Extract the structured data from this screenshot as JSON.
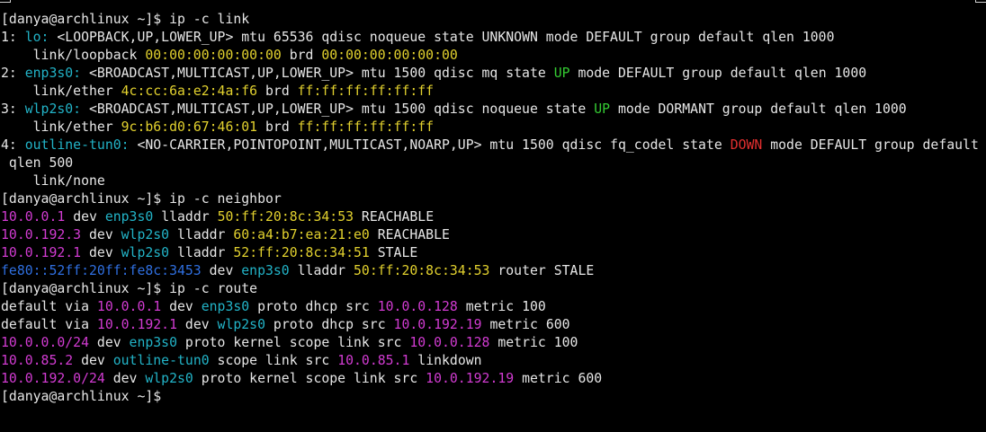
{
  "terminal": {
    "colors": {
      "background": "#000000",
      "default": "#e6e6e6",
      "cyan": "#22b3c7",
      "yellow": "#e2d12e",
      "magenta": "#d13bd1",
      "green": "#35cc33",
      "red": "#e32f2f",
      "blue": "#2f6fe0"
    },
    "lines": [
      [
        {
          "t": "[danya@archlinux ~]$ ip -c link",
          "c": "default"
        }
      ],
      [
        {
          "t": "1: ",
          "c": "default"
        },
        {
          "t": "lo:",
          "c": "cyan"
        },
        {
          "t": " <LOOPBACK,UP,LOWER_UP> mtu 65536 qdisc noqueue state UNKNOWN mode DEFAULT group default qlen 1000",
          "c": "default"
        }
      ],
      [
        {
          "t": "    link/loopback ",
          "c": "default"
        },
        {
          "t": "00:00:00:00:00:00",
          "c": "yellow"
        },
        {
          "t": " brd ",
          "c": "default"
        },
        {
          "t": "00:00:00:00:00:00",
          "c": "yellow"
        }
      ],
      [
        {
          "t": "2: ",
          "c": "default"
        },
        {
          "t": "enp3s0:",
          "c": "cyan"
        },
        {
          "t": " <BROADCAST,MULTICAST,UP,LOWER_UP> mtu 1500 qdisc mq state ",
          "c": "default"
        },
        {
          "t": "UP",
          "c": "green"
        },
        {
          "t": " mode DEFAULT group default qlen 1000",
          "c": "default"
        }
      ],
      [
        {
          "t": "    link/ether ",
          "c": "default"
        },
        {
          "t": "4c:cc:6a:e2:4a:f6",
          "c": "yellow"
        },
        {
          "t": " brd ",
          "c": "default"
        },
        {
          "t": "ff:ff:ff:ff:ff:ff",
          "c": "yellow"
        }
      ],
      [
        {
          "t": "3: ",
          "c": "default"
        },
        {
          "t": "wlp2s0:",
          "c": "cyan"
        },
        {
          "t": " <BROADCAST,MULTICAST,UP,LOWER_UP> mtu 1500 qdisc noqueue state ",
          "c": "default"
        },
        {
          "t": "UP",
          "c": "green"
        },
        {
          "t": " mode DORMANT group default qlen 1000",
          "c": "default"
        }
      ],
      [
        {
          "t": "    link/ether ",
          "c": "default"
        },
        {
          "t": "9c:b6:d0:67:46:01",
          "c": "yellow"
        },
        {
          "t": " brd ",
          "c": "default"
        },
        {
          "t": "ff:ff:ff:ff:ff:ff",
          "c": "yellow"
        }
      ],
      [
        {
          "t": "4: ",
          "c": "default"
        },
        {
          "t": "outline-tun0:",
          "c": "cyan"
        },
        {
          "t": " <NO-CARRIER,POINTOPOINT,MULTICAST,NOARP,UP> mtu 1500 qdisc fq_codel state ",
          "c": "default"
        },
        {
          "t": "DOWN",
          "c": "red"
        },
        {
          "t": " mode DEFAULT group default",
          "c": "default"
        }
      ],
      [
        {
          "t": " qlen 500",
          "c": "default"
        }
      ],
      [
        {
          "t": "    link/none",
          "c": "default"
        }
      ],
      [
        {
          "t": "[danya@archlinux ~]$ ip -c neighbor",
          "c": "default"
        }
      ],
      [
        {
          "t": "10.0.0.1",
          "c": "magenta"
        },
        {
          "t": " dev ",
          "c": "default"
        },
        {
          "t": "enp3s0",
          "c": "cyan"
        },
        {
          "t": " lladdr ",
          "c": "default"
        },
        {
          "t": "50:ff:20:8c:34:53",
          "c": "yellow"
        },
        {
          "t": " REACHABLE",
          "c": "default"
        }
      ],
      [
        {
          "t": "10.0.192.3",
          "c": "magenta"
        },
        {
          "t": " dev ",
          "c": "default"
        },
        {
          "t": "wlp2s0",
          "c": "cyan"
        },
        {
          "t": " lladdr ",
          "c": "default"
        },
        {
          "t": "60:a4:b7:ea:21:e0",
          "c": "yellow"
        },
        {
          "t": " REACHABLE",
          "c": "default"
        }
      ],
      [
        {
          "t": "10.0.192.1",
          "c": "magenta"
        },
        {
          "t": " dev ",
          "c": "default"
        },
        {
          "t": "wlp2s0",
          "c": "cyan"
        },
        {
          "t": " lladdr ",
          "c": "default"
        },
        {
          "t": "52:ff:20:8c:34:51",
          "c": "yellow"
        },
        {
          "t": " STALE",
          "c": "default"
        }
      ],
      [
        {
          "t": "fe80::52ff:20ff:fe8c:3453",
          "c": "blue"
        },
        {
          "t": " dev ",
          "c": "default"
        },
        {
          "t": "enp3s0",
          "c": "cyan"
        },
        {
          "t": " lladdr ",
          "c": "default"
        },
        {
          "t": "50:ff:20:8c:34:53",
          "c": "yellow"
        },
        {
          "t": " router STALE",
          "c": "default"
        }
      ],
      [
        {
          "t": "[danya@archlinux ~]$ ip -c route",
          "c": "default"
        }
      ],
      [
        {
          "t": "default via ",
          "c": "default"
        },
        {
          "t": "10.0.0.1",
          "c": "magenta"
        },
        {
          "t": " dev ",
          "c": "default"
        },
        {
          "t": "enp3s0",
          "c": "cyan"
        },
        {
          "t": " proto dhcp src ",
          "c": "default"
        },
        {
          "t": "10.0.0.128",
          "c": "magenta"
        },
        {
          "t": " metric 100",
          "c": "default"
        }
      ],
      [
        {
          "t": "default via ",
          "c": "default"
        },
        {
          "t": "10.0.192.1",
          "c": "magenta"
        },
        {
          "t": " dev ",
          "c": "default"
        },
        {
          "t": "wlp2s0",
          "c": "cyan"
        },
        {
          "t": " proto dhcp src ",
          "c": "default"
        },
        {
          "t": "10.0.192.19",
          "c": "magenta"
        },
        {
          "t": " metric 600",
          "c": "default"
        }
      ],
      [
        {
          "t": "10.0.0.0/24",
          "c": "magenta"
        },
        {
          "t": " dev ",
          "c": "default"
        },
        {
          "t": "enp3s0",
          "c": "cyan"
        },
        {
          "t": " proto kernel scope link src ",
          "c": "default"
        },
        {
          "t": "10.0.0.128",
          "c": "magenta"
        },
        {
          "t": " metric 100",
          "c": "default"
        }
      ],
      [
        {
          "t": "10.0.85.2",
          "c": "magenta"
        },
        {
          "t": " dev ",
          "c": "default"
        },
        {
          "t": "outline-tun0",
          "c": "cyan"
        },
        {
          "t": " scope link src ",
          "c": "default"
        },
        {
          "t": "10.0.85.1",
          "c": "magenta"
        },
        {
          "t": " linkdown",
          "c": "default"
        }
      ],
      [
        {
          "t": "10.0.192.0/24",
          "c": "magenta"
        },
        {
          "t": " dev ",
          "c": "default"
        },
        {
          "t": "wlp2s0",
          "c": "cyan"
        },
        {
          "t": " proto kernel scope link src ",
          "c": "default"
        },
        {
          "t": "10.0.192.19",
          "c": "magenta"
        },
        {
          "t": " metric 600",
          "c": "default"
        }
      ],
      [
        {
          "t": "[danya@archlinux ~]$ ",
          "c": "default"
        }
      ]
    ]
  }
}
